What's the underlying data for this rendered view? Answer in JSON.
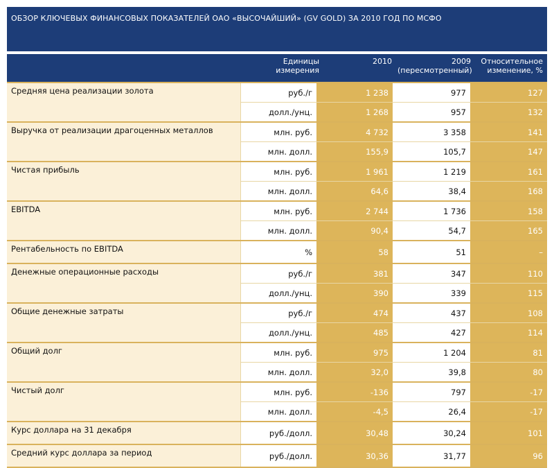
{
  "title": "ОБЗОР КЛЮЧЕВЫХ ФИНАНСОВЫХ ПОКАЗАТЕЛЕЙ ОАО «ВЫСОЧАЙШИЙ» (GV GOLD) ЗА 2010 ГОД ПО МСФО",
  "header": {
    "units": [
      "Единицы",
      "измерения"
    ],
    "y2010": "2010",
    "y2009": [
      "2009",
      "(пересмотренный)"
    ],
    "change": [
      "Относительное",
      "изменение, %"
    ]
  },
  "rows": [
    {
      "name": "Средняя цена реализации золота",
      "lines": [
        {
          "unit": "руб./г",
          "v2010": "1 238",
          "v2009": "977",
          "rel": "127"
        },
        {
          "unit": "долл./унц.",
          "v2010": "1 268",
          "v2009": "957",
          "rel": "132"
        }
      ]
    },
    {
      "name": "Выручка от реализации драгоценных металлов",
      "lines": [
        {
          "unit": "млн. руб.",
          "v2010": "4 732",
          "v2009": "3 358",
          "rel": "141"
        },
        {
          "unit": "млн. долл.",
          "v2010": "155,9",
          "v2009": "105,7",
          "rel": "147"
        }
      ]
    },
    {
      "name": "Чистая прибыль",
      "lines": [
        {
          "unit": "млн. руб.",
          "v2010": "1 961",
          "v2009": "1 219",
          "rel": "161"
        },
        {
          "unit": "млн. долл.",
          "v2010": "64,6",
          "v2009": "38,4",
          "rel": "168"
        }
      ]
    },
    {
      "name": "EBITDA",
      "lines": [
        {
          "unit": "млн. руб.",
          "v2010": "2 744",
          "v2009": "1 736",
          "rel": "158"
        },
        {
          "unit": "млн. долл.",
          "v2010": "90,4",
          "v2009": "54,7",
          "rel": "165"
        }
      ]
    },
    {
      "name": "Рентабельность по EBITDA",
      "lines": [
        {
          "unit": "%",
          "v2010": "58",
          "v2009": "51",
          "rel": "–"
        }
      ]
    },
    {
      "name": "Денежные операционные расходы",
      "lines": [
        {
          "unit": "руб./г",
          "v2010": "381",
          "v2009": "347",
          "rel": "110"
        },
        {
          "unit": "долл./унц.",
          "v2010": "390",
          "v2009": "339",
          "rel": "115"
        }
      ]
    },
    {
      "name": "Общие денежные затраты",
      "lines": [
        {
          "unit": "руб./г",
          "v2010": "474",
          "v2009": "437",
          "rel": "108"
        },
        {
          "unit": "долл./унц.",
          "v2010": "485",
          "v2009": "427",
          "rel": "114"
        }
      ]
    },
    {
      "name": "Общий долг",
      "lines": [
        {
          "unit": "млн. руб.",
          "v2010": "975",
          "v2009": "1 204",
          "rel": "81"
        },
        {
          "unit": "млн. долл.",
          "v2010": "32,0",
          "v2009": "39,8",
          "rel": "80"
        }
      ]
    },
    {
      "name": "Чистый долг",
      "lines": [
        {
          "unit": "млн. руб.",
          "v2010": "-136",
          "v2009": "797",
          "rel": "-17"
        },
        {
          "unit": "млн. долл.",
          "v2010": "-4,5",
          "v2009": "26,4",
          "rel": "-17"
        }
      ]
    },
    {
      "name": "Курс доллара на 31 декабря",
      "lines": [
        {
          "unit": "руб./долл.",
          "v2010": "30,48",
          "v2009": "30,24",
          "rel": "101"
        }
      ]
    },
    {
      "name": "Средний курс доллара за период",
      "lines": [
        {
          "unit": "руб./долл.",
          "v2010": "30,36",
          "v2009": "31,77",
          "rel": "96"
        }
      ]
    }
  ],
  "colors": {
    "navy": "#1d3d78",
    "gold": "#ddb55a",
    "cream": "#fbf0d8",
    "rule": "#e8d6a4"
  }
}
